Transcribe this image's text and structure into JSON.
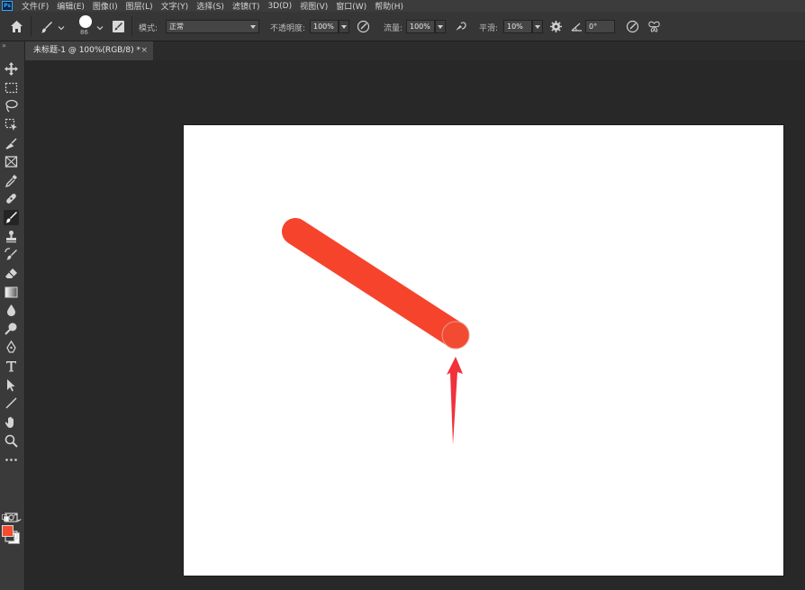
{
  "menubar": {
    "logo": "Ps",
    "items": [
      "文件(F)",
      "编辑(E)",
      "图像(I)",
      "图层(L)",
      "文字(Y)",
      "选择(S)",
      "滤镜(T)",
      "3D(D)",
      "视图(V)",
      "窗口(W)",
      "帮助(H)"
    ]
  },
  "options": {
    "brush_size": "86",
    "mode_label": "模式:",
    "mode_value": "正常",
    "opacity_label": "不透明度:",
    "opacity_value": "100%",
    "flow_label": "流量:",
    "flow_value": "100%",
    "smoothing_label": "平滑:",
    "smoothing_value": "10%",
    "angle_value": "0°"
  },
  "document": {
    "tab_title": "未标题-1 @ 100%(RGB/8) *",
    "close_glyph": "×"
  },
  "toolbar": {
    "collapse_glyph": "»",
    "foreground_color": "#f54b2f",
    "background_color": "#ffffff",
    "active_tool": "brush-tool"
  },
  "canvas": {
    "background": "#ffffff",
    "stroke_color": "#f54b2f",
    "annotation_arrow_color": "#f0323c"
  }
}
